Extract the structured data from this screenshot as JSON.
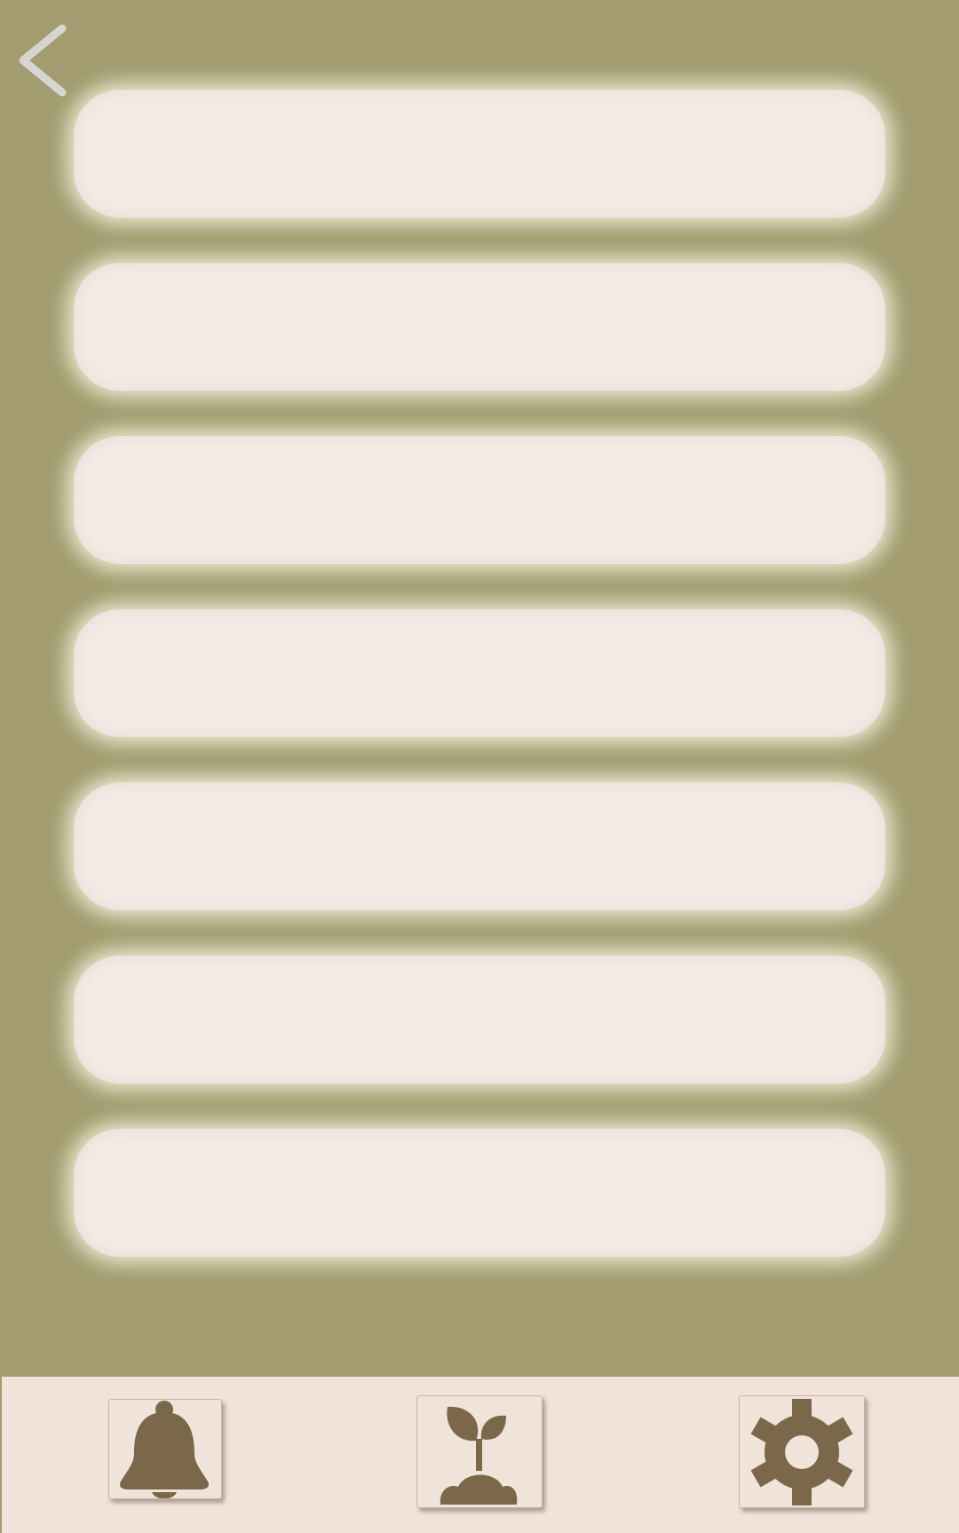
{
  "screen": {
    "background_color": "#a29c70",
    "back_icon": "chevron-left-icon",
    "back_icon_color": "#d7d5d2"
  },
  "list": {
    "item_color": "#f4ece7",
    "items": [
      {
        "label": ""
      },
      {
        "label": ""
      },
      {
        "label": ""
      },
      {
        "label": ""
      },
      {
        "label": ""
      },
      {
        "label": ""
      },
      {
        "label": ""
      }
    ]
  },
  "bottom_nav": {
    "background_color": "#efe3da",
    "icon_color": "#7b684b",
    "buttons": [
      {
        "icon": "bell-icon"
      },
      {
        "icon": "plant-icon"
      },
      {
        "icon": "gear-icon"
      }
    ]
  }
}
